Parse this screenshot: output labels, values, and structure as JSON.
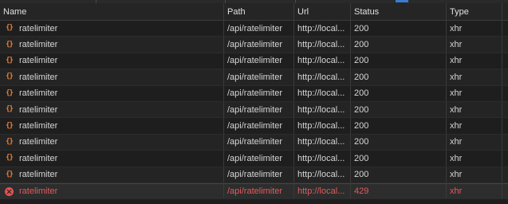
{
  "columns": {
    "name": "Name",
    "path": "Path",
    "url": "Url",
    "status": "Status",
    "type": "Type"
  },
  "requests": [
    {
      "name": "ratelimiter",
      "path": "/api/ratelimiter",
      "url": "http://local...",
      "status": "200",
      "type": "xhr",
      "icon": "xhr-icon"
    },
    {
      "name": "ratelimiter",
      "path": "/api/ratelimiter",
      "url": "http://local...",
      "status": "200",
      "type": "xhr",
      "icon": "xhr-icon"
    },
    {
      "name": "ratelimiter",
      "path": "/api/ratelimiter",
      "url": "http://local...",
      "status": "200",
      "type": "xhr",
      "icon": "xhr-icon"
    },
    {
      "name": "ratelimiter",
      "path": "/api/ratelimiter",
      "url": "http://local...",
      "status": "200",
      "type": "xhr",
      "icon": "xhr-icon"
    },
    {
      "name": "ratelimiter",
      "path": "/api/ratelimiter",
      "url": "http://local...",
      "status": "200",
      "type": "xhr",
      "icon": "xhr-icon"
    },
    {
      "name": "ratelimiter",
      "path": "/api/ratelimiter",
      "url": "http://local...",
      "status": "200",
      "type": "xhr",
      "icon": "xhr-icon"
    },
    {
      "name": "ratelimiter",
      "path": "/api/ratelimiter",
      "url": "http://local...",
      "status": "200",
      "type": "xhr",
      "icon": "xhr-icon"
    },
    {
      "name": "ratelimiter",
      "path": "/api/ratelimiter",
      "url": "http://local...",
      "status": "200",
      "type": "xhr",
      "icon": "xhr-icon"
    },
    {
      "name": "ratelimiter",
      "path": "/api/ratelimiter",
      "url": "http://local...",
      "status": "200",
      "type": "xhr",
      "icon": "xhr-icon"
    },
    {
      "name": "ratelimiter",
      "path": "/api/ratelimiter",
      "url": "http://local...",
      "status": "200",
      "type": "xhr",
      "icon": "xhr-icon"
    },
    {
      "name": "ratelimiter",
      "path": "/api/ratelimiter",
      "url": "http://local...",
      "status": "429",
      "type": "xhr",
      "icon": "error-icon",
      "error": true
    }
  ],
  "colors": {
    "background": "#1e1e1e",
    "error_text": "#e35b5b",
    "xhr_icon": "#e8803a",
    "error_icon": "#e05252"
  }
}
